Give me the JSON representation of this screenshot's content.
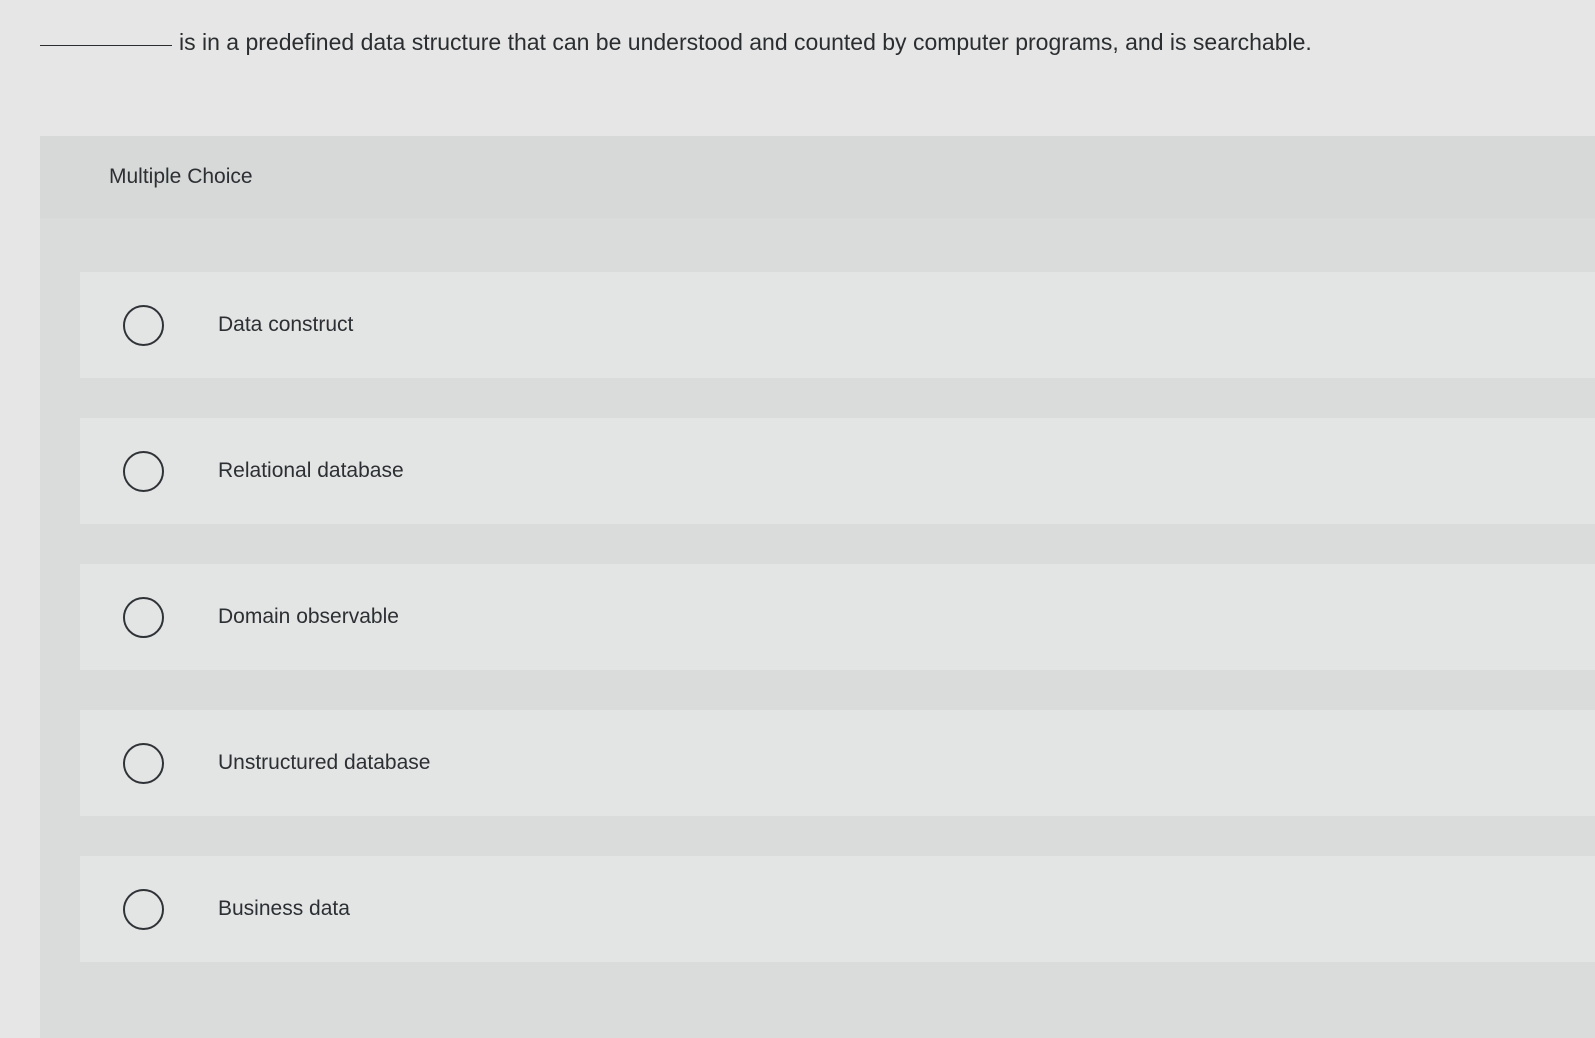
{
  "question": {
    "text": "is in a predefined data structure that can be understood and counted by computer programs, and is searchable."
  },
  "multiple_choice": {
    "header": "Multiple Choice",
    "options": [
      {
        "label": "Data construct"
      },
      {
        "label": "Relational database"
      },
      {
        "label": "Domain observable"
      },
      {
        "label": "Unstructured database"
      },
      {
        "label": "Business data"
      }
    ]
  },
  "colors": {
    "background": "#e5e6e5",
    "panel": "#dadcdb",
    "option_row": "#e3e5e4",
    "text": "#2c2f33"
  }
}
